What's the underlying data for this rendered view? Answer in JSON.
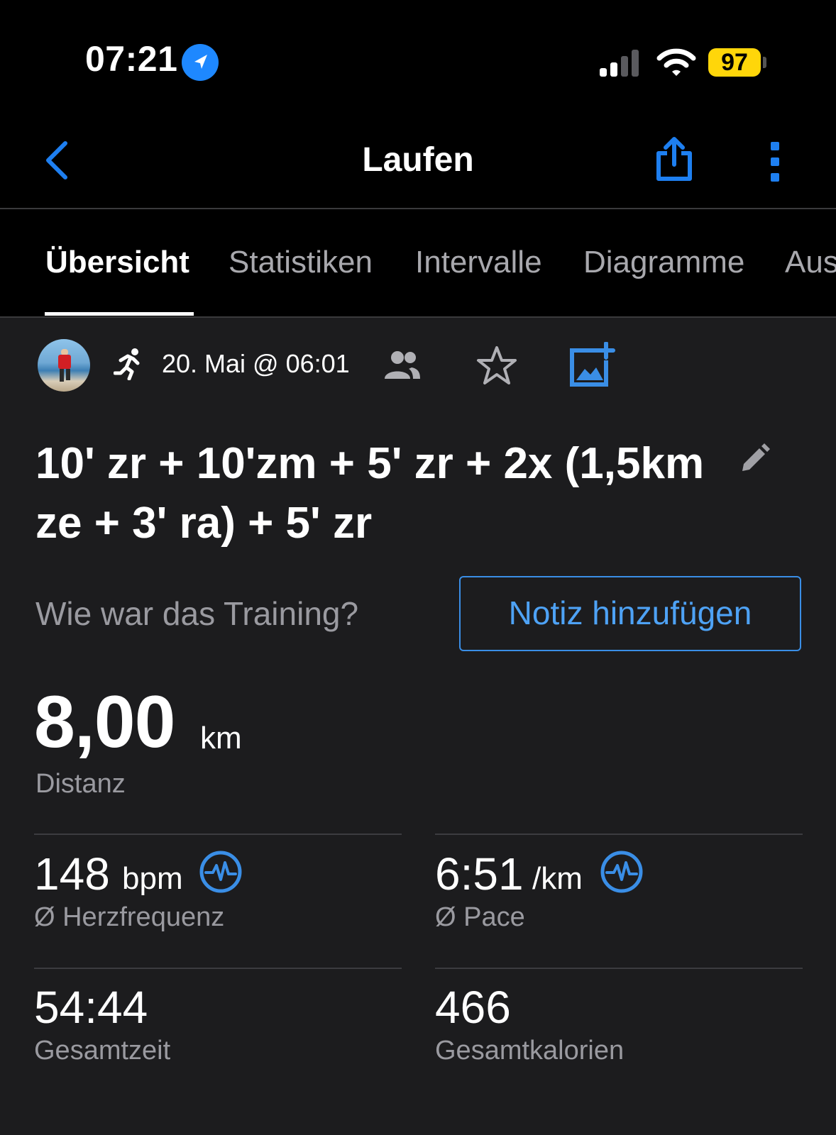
{
  "status_bar": {
    "time": "07:21",
    "battery": "97"
  },
  "nav": {
    "title": "Laufen"
  },
  "tabs": [
    {
      "label": "Übersicht",
      "active": true
    },
    {
      "label": "Statistiken",
      "active": false
    },
    {
      "label": "Intervalle",
      "active": false
    },
    {
      "label": "Diagramme",
      "active": false
    },
    {
      "label": "Aus",
      "active": false
    }
  ],
  "activity": {
    "date": "20. Mai @ 06:01",
    "title": "10' zr + 10'zm + 5' zr + 2x (1,5km ze + 3' ra) + 5' zr",
    "feedback_question": "Wie war das Training?",
    "note_button": "Notiz hinzufügen"
  },
  "summary": {
    "distance": {
      "value": "8,00",
      "unit": "km",
      "label": "Distanz"
    },
    "heart_rate": {
      "value": "148",
      "unit": "bpm",
      "label": "Ø Herzfrequenz"
    },
    "pace": {
      "value": "6:51",
      "unit": "/km",
      "label": "Ø Pace"
    },
    "total_time": {
      "value": "54:44",
      "label": "Gesamtzeit"
    },
    "calories": {
      "value": "466",
      "label": "Gesamtkalorien"
    }
  },
  "colors": {
    "accent": "#3a8ee6",
    "background": "#1c1c1e",
    "battery": "#ffd60a"
  },
  "icons": [
    "location-arrow-icon",
    "cellular-signal-icon",
    "wifi-icon",
    "battery-icon",
    "back-chevron-icon",
    "share-icon",
    "more-vertical-icon",
    "running-icon",
    "people-icon",
    "star-icon",
    "add-photo-icon",
    "edit-pencil-icon",
    "pulse-icon"
  ]
}
